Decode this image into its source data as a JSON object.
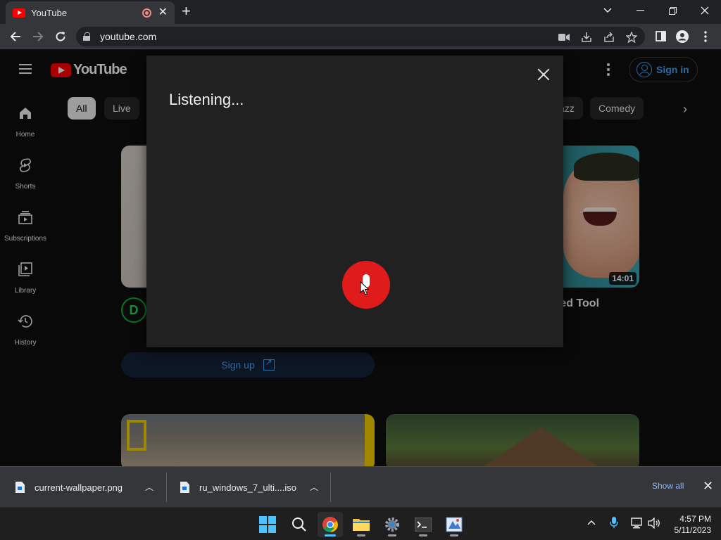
{
  "browser": {
    "tab_title": "YouTube",
    "tab_close": "✕",
    "new_tab": "+",
    "url": "youtube.com"
  },
  "youtube": {
    "logo_text": "YouTube",
    "signin_label": "Sign in",
    "sidebar": [
      {
        "label": "Home"
      },
      {
        "label": "Shorts"
      },
      {
        "label": "Subscriptions"
      },
      {
        "label": "Library"
      },
      {
        "label": "History"
      }
    ],
    "chips": [
      "All",
      "Live",
      "azz",
      "Comedy"
    ],
    "video_right_duration": "14:01",
    "video_title_fragment": "ted Tool",
    "signup_label": "Sign up",
    "channel_icon_glyph": "D"
  },
  "voice_dialog": {
    "status": "Listening..."
  },
  "downloads": {
    "items": [
      {
        "name": "current-wallpaper.png"
      },
      {
        "name": "ru_windows_7_ulti....iso"
      }
    ],
    "show_all": "Show all"
  },
  "taskbar": {
    "time": "4:57 PM",
    "date": "5/11/2023"
  },
  "colors": {
    "youtube_red": "#ff0000",
    "mic_red": "#e01b1b",
    "link_blue": "#3ea6ff"
  }
}
